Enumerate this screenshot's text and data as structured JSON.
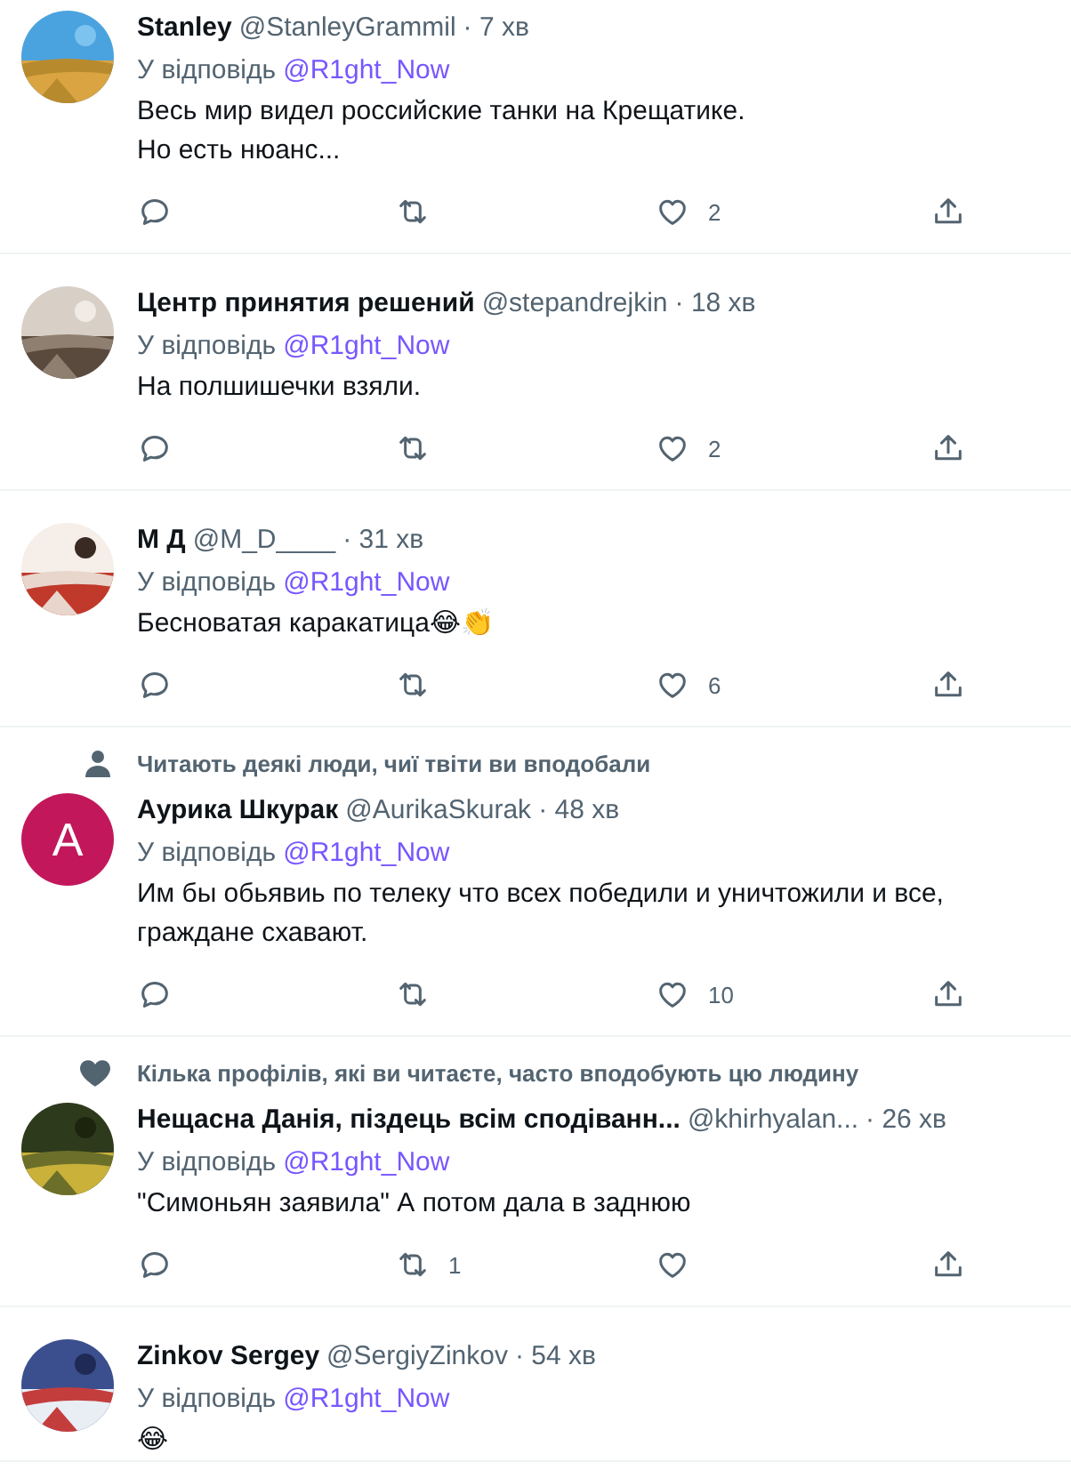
{
  "tweets": [
    {
      "avatar": {
        "kind": "picture"
      },
      "name": "Stanley",
      "handle": "@StanleyGrammil",
      "time": "· 7 хв",
      "reply_label": "У відповідь",
      "reply_to": "@R1ght_Now",
      "lines": [
        "Весь мир видел российские танки на Крещатике.",
        "Но есть нюанс..."
      ],
      "actions": [
        {
          "kind": "reply"
        },
        {
          "kind": "retweet"
        },
        {
          "kind": "like",
          "count": "2"
        },
        {
          "kind": "share"
        }
      ]
    },
    {
      "avatar": {
        "kind": "picture"
      },
      "name": "Центр принятия решений",
      "handle": "@stepandrejkin",
      "time": "· 18 хв",
      "reply_label": "У відповідь",
      "reply_to": "@R1ght_Now",
      "lines": [
        "На полшишечки взяли."
      ],
      "actions": [
        {
          "kind": "reply"
        },
        {
          "kind": "retweet"
        },
        {
          "kind": "like",
          "count": "2"
        },
        {
          "kind": "share"
        }
      ]
    },
    {
      "avatar": {
        "kind": "picture"
      },
      "name": "М Д",
      "handle": "@M_D____",
      "time": "· 31 хв",
      "reply_label": "У відповідь",
      "reply_to": "@R1ght_Now",
      "lines": [
        "Бесноватая каракатица😂👏"
      ],
      "actions": [
        {
          "kind": "reply"
        },
        {
          "kind": "retweet"
        },
        {
          "kind": "like",
          "count": "6"
        },
        {
          "kind": "share"
        }
      ]
    },
    {
      "context": {
        "kind": "person",
        "text": "Читають деякі люди, чиї твіти ви вподобали"
      },
      "avatar": {
        "kind": "letter",
        "letter": "A",
        "color": "#c2185b"
      },
      "name": "Аурика Шкурак",
      "handle": "@AurikaSkurak",
      "time": "· 48 хв",
      "reply_label": "У відповідь",
      "reply_to": "@R1ght_Now",
      "lines": [
        "Им бы обьявиь по телеку что всех победили и уничтожили и все,",
        "граждане схавают."
      ],
      "actions": [
        {
          "kind": "reply"
        },
        {
          "kind": "retweet"
        },
        {
          "kind": "like",
          "count": "10"
        },
        {
          "kind": "share"
        }
      ]
    },
    {
      "context": {
        "kind": "heart",
        "text": "Кілька профілів, які ви читаєте, часто вподобують цю людину"
      },
      "avatar": {
        "kind": "picture"
      },
      "name": "Нещасна Данія, піздець всім сподіванн...",
      "handle": "@khirhyalan...",
      "time": "· 26 хв",
      "reply_label": "У відповідь",
      "reply_to": "@R1ght_Now",
      "lines": [
        "\"Симоньян заявила\" А потом дала в заднюю"
      ],
      "actions": [
        {
          "kind": "reply"
        },
        {
          "kind": "retweet",
          "count": "1"
        },
        {
          "kind": "like"
        },
        {
          "kind": "share"
        }
      ]
    },
    {
      "avatar": {
        "kind": "picture"
      },
      "name": "Zinkov Sergey",
      "handle": "@SergiyZinkov",
      "time": "· 54 хв",
      "reply_label": "У відповідь",
      "reply_to": "@R1ght_Now",
      "lines": [
        "😂"
      ]
    }
  ]
}
